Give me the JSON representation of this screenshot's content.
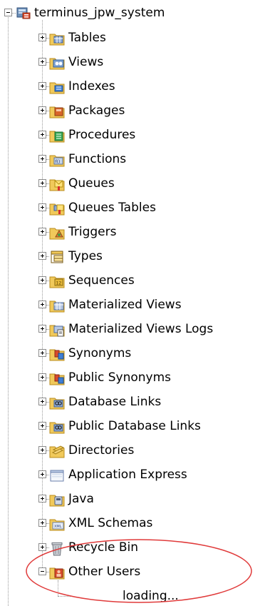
{
  "tree": {
    "root": {
      "label": "terminus_jpw_system",
      "expanded": true
    },
    "items": [
      {
        "label": "Tables",
        "icon": "table-folder-icon",
        "expander": "+"
      },
      {
        "label": "Views",
        "icon": "view-folder-icon",
        "expander": "+"
      },
      {
        "label": "Indexes",
        "icon": "index-folder-icon",
        "expander": "+"
      },
      {
        "label": "Packages",
        "icon": "package-folder-icon",
        "expander": "+"
      },
      {
        "label": "Procedures",
        "icon": "procedure-folder-icon",
        "expander": "+"
      },
      {
        "label": "Functions",
        "icon": "function-folder-icon",
        "expander": "+"
      },
      {
        "label": "Queues",
        "icon": "queue-folder-icon",
        "expander": "+"
      },
      {
        "label": "Queues Tables",
        "icon": "queue-table-folder-icon",
        "expander": "+"
      },
      {
        "label": "Triggers",
        "icon": "trigger-folder-icon",
        "expander": "+"
      },
      {
        "label": "Types",
        "icon": "type-folder-icon",
        "expander": "+"
      },
      {
        "label": "Sequences",
        "icon": "sequence-folder-icon",
        "expander": "+"
      },
      {
        "label": "Materialized Views",
        "icon": "materialized-view-folder-icon",
        "expander": "+"
      },
      {
        "label": "Materialized Views Logs",
        "icon": "materialized-view-log-folder-icon",
        "expander": "+"
      },
      {
        "label": "Synonyms",
        "icon": "synonym-folder-icon",
        "expander": "+"
      },
      {
        "label": "Public Synonyms",
        "icon": "public-synonym-folder-icon",
        "expander": "+"
      },
      {
        "label": "Database Links",
        "icon": "database-link-folder-icon",
        "expander": "+"
      },
      {
        "label": "Public Database Links",
        "icon": "public-database-link-folder-icon",
        "expander": "+"
      },
      {
        "label": "Directories",
        "icon": "directory-folder-icon",
        "expander": "+"
      },
      {
        "label": "Application Express",
        "icon": "application-express-folder-icon",
        "expander": "+"
      },
      {
        "label": "Java",
        "icon": "java-folder-icon",
        "expander": "+"
      },
      {
        "label": "XML Schemas",
        "icon": "xml-schema-folder-icon",
        "expander": "+"
      },
      {
        "label": "Recycle Bin",
        "icon": "recycle-bin-icon",
        "expander": "+"
      },
      {
        "label": "Other Users",
        "icon": "other-users-folder-icon",
        "expander": "-"
      }
    ],
    "loading": {
      "label": "loading..."
    }
  },
  "colors": {
    "annotation_ellipse": "#e03a3a",
    "tree_lines": "#9a9a9a",
    "folder_fill": "#f1c95a"
  }
}
